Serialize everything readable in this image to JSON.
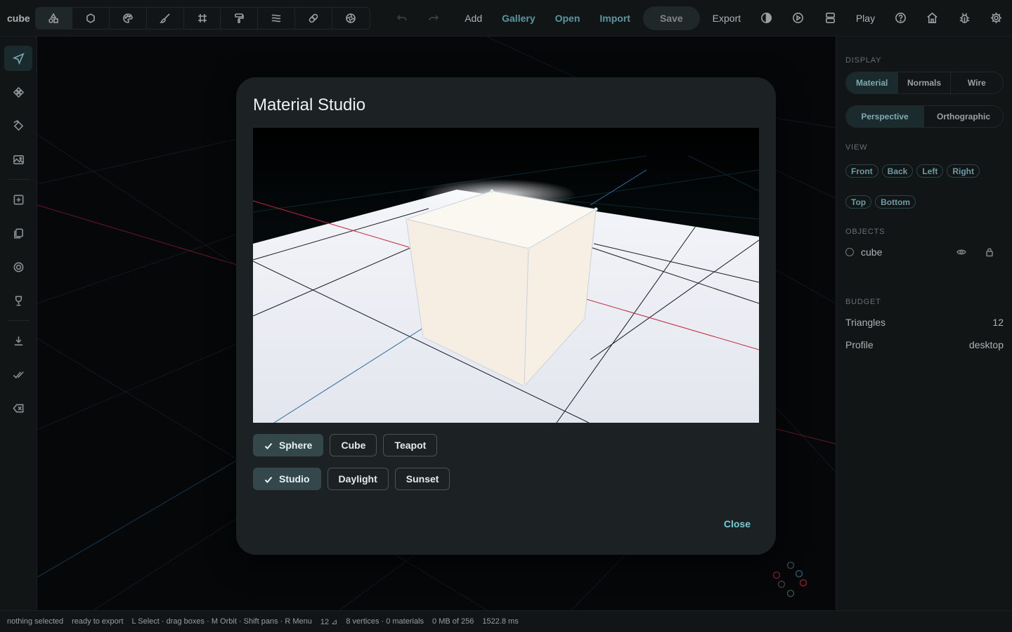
{
  "app": {
    "title": "cube"
  },
  "toolbar": {
    "tools": [
      {
        "name": "shapes-tool",
        "icon": "shapes-icon",
        "active": true
      },
      {
        "name": "circle-tool",
        "icon": "circle-icon"
      },
      {
        "name": "palette-tool",
        "icon": "palette-icon"
      },
      {
        "name": "brush-tool",
        "icon": "brush-icon"
      },
      {
        "name": "grid-tool",
        "icon": "grid-icon"
      },
      {
        "name": "paint-roller-tool",
        "icon": "paint-roller-icon"
      },
      {
        "name": "texture-tool",
        "icon": "texture-icon"
      },
      {
        "name": "bandage-tool",
        "icon": "bandage-icon"
      },
      {
        "name": "aperture-tool",
        "icon": "aperture-icon"
      }
    ],
    "add": "Add",
    "gallery": "Gallery",
    "open": "Open",
    "import": "Import",
    "save": "Save",
    "export": "Export",
    "play": "Play"
  },
  "modal": {
    "title": "Material Studio",
    "shapes": [
      {
        "label": "Sphere",
        "selected": true
      },
      {
        "label": "Cube",
        "selected": false
      },
      {
        "label": "Teapot",
        "selected": false
      }
    ],
    "lighting": [
      {
        "label": "Studio",
        "selected": true
      },
      {
        "label": "Daylight",
        "selected": false
      },
      {
        "label": "Sunset",
        "selected": false
      }
    ],
    "close": "Close"
  },
  "panel": {
    "display_label": "DISPLAY",
    "display_modes": [
      {
        "label": "Material",
        "active": true
      },
      {
        "label": "Normals",
        "active": false
      },
      {
        "label": "Wire",
        "active": false
      }
    ],
    "projections": [
      {
        "label": "Perspective",
        "active": true
      },
      {
        "label": "Orthographic",
        "active": false
      }
    ],
    "view_label": "VIEW",
    "views_row1": [
      "Front",
      "Back",
      "Left",
      "Right"
    ],
    "views_row2": [
      "Top",
      "Bottom"
    ],
    "objects_label": "OBJECTS",
    "objects": [
      {
        "name": "cube"
      }
    ],
    "budget_label": "BUDGET",
    "triangles_label": "Triangles",
    "triangles_value": "12",
    "profile_label": "Profile",
    "profile_value": "desktop"
  },
  "status": {
    "selection": "nothing selected",
    "state": "ready to export",
    "hints": "L Select · drag boxes · M Orbit · Shift pans · R Menu",
    "triangles": "12 ⊿",
    "geometry": "8 vertices · 0 materials",
    "memory": "0 MB of 256",
    "timing": "1522.8 ms"
  },
  "colors": {
    "accent": "#79c8d8",
    "axis_x": "#c02a3c",
    "axis_z": "#2e6aa0",
    "cube": "#f6eee3"
  }
}
